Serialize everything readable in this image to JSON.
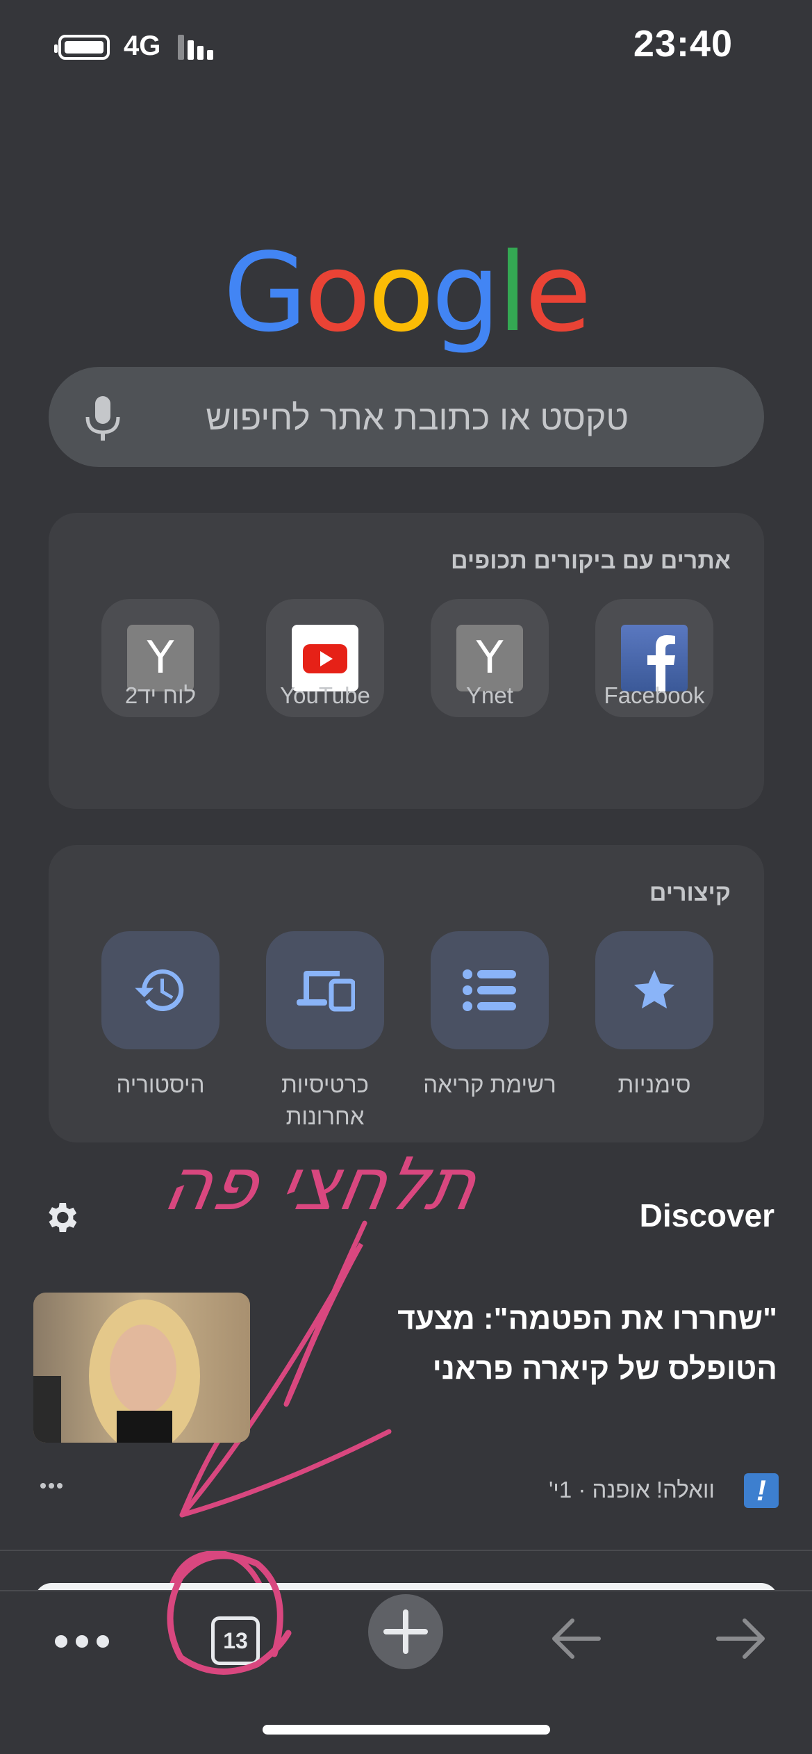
{
  "status_bar": {
    "time": "23:40",
    "network": "4G"
  },
  "logo": {
    "letters": [
      {
        "char": "G",
        "color": "#4285f4"
      },
      {
        "char": "o",
        "color": "#ea4335"
      },
      {
        "char": "o",
        "color": "#fbbc05"
      },
      {
        "char": "g",
        "color": "#4285f4"
      },
      {
        "char": "l",
        "color": "#34a853"
      },
      {
        "char": "e",
        "color": "#ea4335"
      }
    ]
  },
  "search": {
    "placeholder": "טקסט או כתובת אתר לחיפוש"
  },
  "most_visited": {
    "title": "אתרים עם ביקורים תכופים",
    "sites": [
      {
        "label": "Facebook",
        "icon": "facebook-icon"
      },
      {
        "label": "Ynet",
        "icon": "y-letter-icon"
      },
      {
        "label": "YouTube",
        "icon": "youtube-icon"
      },
      {
        "label": "לוח יד2",
        "icon": "y-letter-icon"
      }
    ]
  },
  "shortcuts": {
    "title": "קיצורים",
    "items": [
      {
        "label": "סימניות",
        "icon": "star-icon"
      },
      {
        "label": "רשימת קריאה",
        "icon": "reading-list-icon"
      },
      {
        "label": "כרטיסיות אחרונות",
        "icon": "recent-tabs-icon"
      },
      {
        "label": "היסטוריה",
        "icon": "history-icon"
      }
    ]
  },
  "annotation": {
    "text": "תלחצי פה",
    "color": "#d9477f"
  },
  "discover": {
    "title": "Discover",
    "article": {
      "headline": "\"שחררו את הפטמה\": מצעד הטופלס של קיארה פראני",
      "source": "וואלה! אופנה",
      "age": "1י'",
      "source_logo": "!"
    }
  },
  "toolbar": {
    "tab_count": "13"
  },
  "colors": {
    "background": "#35363a",
    "card": "#3e3f43",
    "shortcut_tile": "#4a5163",
    "shortcut_icon": "#8ab4f8",
    "annotation": "#d9477f"
  }
}
